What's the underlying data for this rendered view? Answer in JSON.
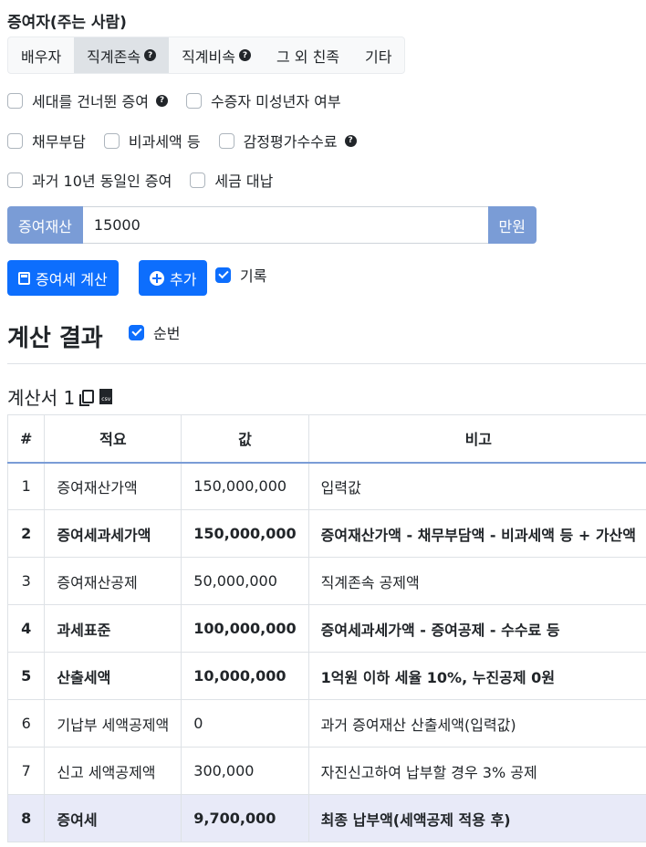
{
  "section_title": "증여자(주는 사람)",
  "tabs": [
    {
      "label": "배우자",
      "active": false,
      "help": false
    },
    {
      "label": "직계존속",
      "active": true,
      "help": true
    },
    {
      "label": "직계비속",
      "active": false,
      "help": true
    },
    {
      "label": "그 외 친족",
      "active": false,
      "help": false
    },
    {
      "label": "기타",
      "active": false,
      "help": false
    }
  ],
  "options": {
    "skip_generation": "세대를 건너뛴 증여",
    "minor_recipient": "수증자 미성년자 여부",
    "debt": "채무부담",
    "nontaxable": "비과세액 등",
    "appraisal_fee": "감정평가수수료",
    "past_10y": "과거 10년 동일인 증여",
    "tax_payment": "세금 대납"
  },
  "property_input": {
    "label": "증여재산",
    "value": "15000",
    "unit": "만원"
  },
  "buttons": {
    "calculate": "증여세 계산",
    "add": "추가"
  },
  "record_label": "기록",
  "result_title": "계산 결과",
  "sequence_label": "순번",
  "statement_title": "계산서 1",
  "csv_icon_text": "csv",
  "table": {
    "headers": [
      "#",
      "적요",
      "값",
      "비고"
    ],
    "rows": [
      {
        "no": "1",
        "item": "증여재산가액",
        "value": "150,000,000",
        "note": "입력값"
      },
      {
        "no": "2",
        "item": "증여세과세가액",
        "value": "150,000,000",
        "note": "증여재산가액 - 채무부담액 - 비과세액 등 + 가산액"
      },
      {
        "no": "3",
        "item": "증여재산공제",
        "value": "50,000,000",
        "note": "직계존속 공제액"
      },
      {
        "no": "4",
        "item": "과세표준",
        "value": "100,000,000",
        "note": "증여세과세가액 - 증여공제 - 수수료 등"
      },
      {
        "no": "5",
        "item": "산출세액",
        "value": "10,000,000",
        "note": "1억원 이하 세율 10%, 누진공제 0원"
      },
      {
        "no": "6",
        "item": "기납부 세액공제액",
        "value": "0",
        "note": "과거 증여재산 산출세액(입력값)"
      },
      {
        "no": "7",
        "item": "신고 세액공제액",
        "value": "300,000",
        "note": "자진신고하여 납부할 경우 3% 공제"
      },
      {
        "no": "8",
        "item": "증여세",
        "value": "9,700,000",
        "note": "최종 납부액(세액공제 적용 후)"
      }
    ]
  }
}
